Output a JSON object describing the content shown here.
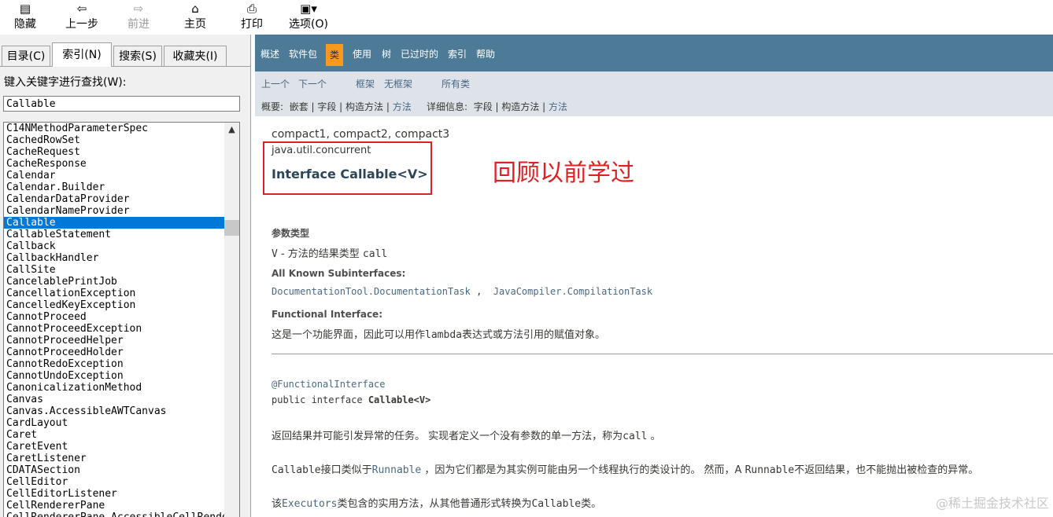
{
  "toolbar": {
    "hide": {
      "icon": "hide-icon",
      "label": "隐藏"
    },
    "back": {
      "icon": "back-arrow-icon",
      "label": "上一步"
    },
    "forward": {
      "icon": "forward-arrow-icon",
      "label": "前进"
    },
    "home": {
      "icon": "home-icon",
      "label": "主页"
    },
    "print": {
      "icon": "printer-icon",
      "label": "打印"
    },
    "options": {
      "icon": "options-icon",
      "label": "选项(O)"
    }
  },
  "left": {
    "tabs": [
      "目录(C)",
      "索引(N)",
      "搜索(S)",
      "收藏夹(I)"
    ],
    "active_tab": "索引(N)",
    "search_label": "键入关键字进行查找(W):",
    "search_value": "Callable",
    "list": [
      "C14NMethodParameterSpec",
      "CachedRowSet",
      "CacheRequest",
      "CacheResponse",
      "Calendar",
      "Calendar.Builder",
      "CalendarDataProvider",
      "CalendarNameProvider",
      "Callable",
      "CallableStatement",
      "Callback",
      "CallbackHandler",
      "CallSite",
      "CancelablePrintJob",
      "CancellationException",
      "CancelledKeyException",
      "CannotProceed",
      "CannotProceedException",
      "CannotProceedHelper",
      "CannotProceedHolder",
      "CannotRedoException",
      "CannotUndoException",
      "CanonicalizationMethod",
      "Canvas",
      "Canvas.AccessibleAWTCanvas",
      "CardLayout",
      "Caret",
      "CaretEvent",
      "CaretListener",
      "CDATASection",
      "CellEditor",
      "CellEditorListener",
      "CellRendererPane",
      "CellRendererPane.AccessibleCellRendererPane"
    ],
    "selected": "Callable"
  },
  "navbar": {
    "items": [
      "概述",
      "软件包",
      "类",
      "使用",
      "树",
      "已过时的",
      "索引",
      "帮助"
    ],
    "active": "类"
  },
  "subnav": {
    "prev": "上一个",
    "next": "下一个",
    "frames": "框架",
    "noframes": "无框架",
    "allclasses": "所有类",
    "summary_label": "概要:",
    "summary": "嵌套 | 字段 | 构造方法 | ",
    "summary_link": "方法",
    "detail_label": "详细信息:",
    "detail": "字段 | 构造方法 | ",
    "detail_link": "方法"
  },
  "content": {
    "profiles": "compact1, compact2, compact3",
    "package": "java.util.concurrent",
    "title": "Interface Callable<V>",
    "annotation": "回顾以前学过",
    "param_heading": "参数类型",
    "param_code": "V",
    "param_sep": " - 方法的结果类型 ",
    "param_call": "call",
    "subinterfaces_heading": "All Known Subinterfaces:",
    "subinterface_1": "DocumentationTool.DocumentationTask",
    "subinterface_sep": " , ",
    "subinterface_2": "JavaCompiler.CompilationTask",
    "functional_heading": "Functional Interface:",
    "functional_pre": "这是一个功能界面，因此可以用作",
    "functional_code": "lambda",
    "functional_post": "表达式或方法引用的赋值对象。",
    "annotation_decl": "@FunctionalInterface",
    "decl_pre": "public interface ",
    "decl_name": "Callable<V>",
    "desc1_pre": "返回结果并可能引发异常的任务。 实现者定义一个没有参数的单一方法，称为",
    "desc1_code": "call",
    "desc1_post": " 。",
    "desc2_code1": "Callable",
    "desc2_a": "接口类似于",
    "desc2_link": "Runnable",
    "desc2_b": " ，因为它们都是为其实例可能由另一个线程执行的类设计的。 然而，A ",
    "desc2_code2": "Runnable",
    "desc2_c": "不返回结果，也不能抛出被检查的异常。",
    "desc3_a": "该",
    "desc3_link": "Executors",
    "desc3_b": "类包含的实用方法，从其他普通形式转换为",
    "desc3_code": "Callable",
    "desc3_c": "类。"
  },
  "watermark": "@稀土掘金技术社区"
}
